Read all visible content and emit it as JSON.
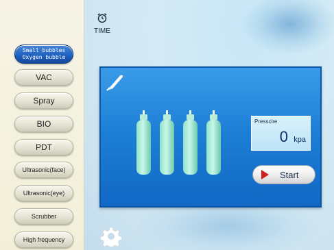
{
  "sidebar": {
    "active_mode": {
      "line1": "Small bubbles",
      "line2": "Oxygen bubble"
    },
    "items": [
      {
        "label": "VAC"
      },
      {
        "label": "Spray"
      },
      {
        "label": "BIO"
      },
      {
        "label": "PDT"
      },
      {
        "label": "Ultrasonic(face)"
      },
      {
        "label": "Ultrasonic(eye)"
      },
      {
        "label": "Scrubber"
      },
      {
        "label": "High frequency"
      }
    ]
  },
  "header": {
    "time_label": "TIME",
    "time_icon": "alarm-clock-icon"
  },
  "panel": {
    "tool_icon": "handpiece-icon",
    "bottle_count": 4,
    "pressure": {
      "label": "Presscire",
      "value": "0",
      "unit": "kpa"
    },
    "start_label": "Start"
  },
  "settings_icon": "gear-icon",
  "colors": {
    "accent": "#1e7fd6",
    "active": "#1d5fbf",
    "start_triangle": "#d01f1f"
  }
}
